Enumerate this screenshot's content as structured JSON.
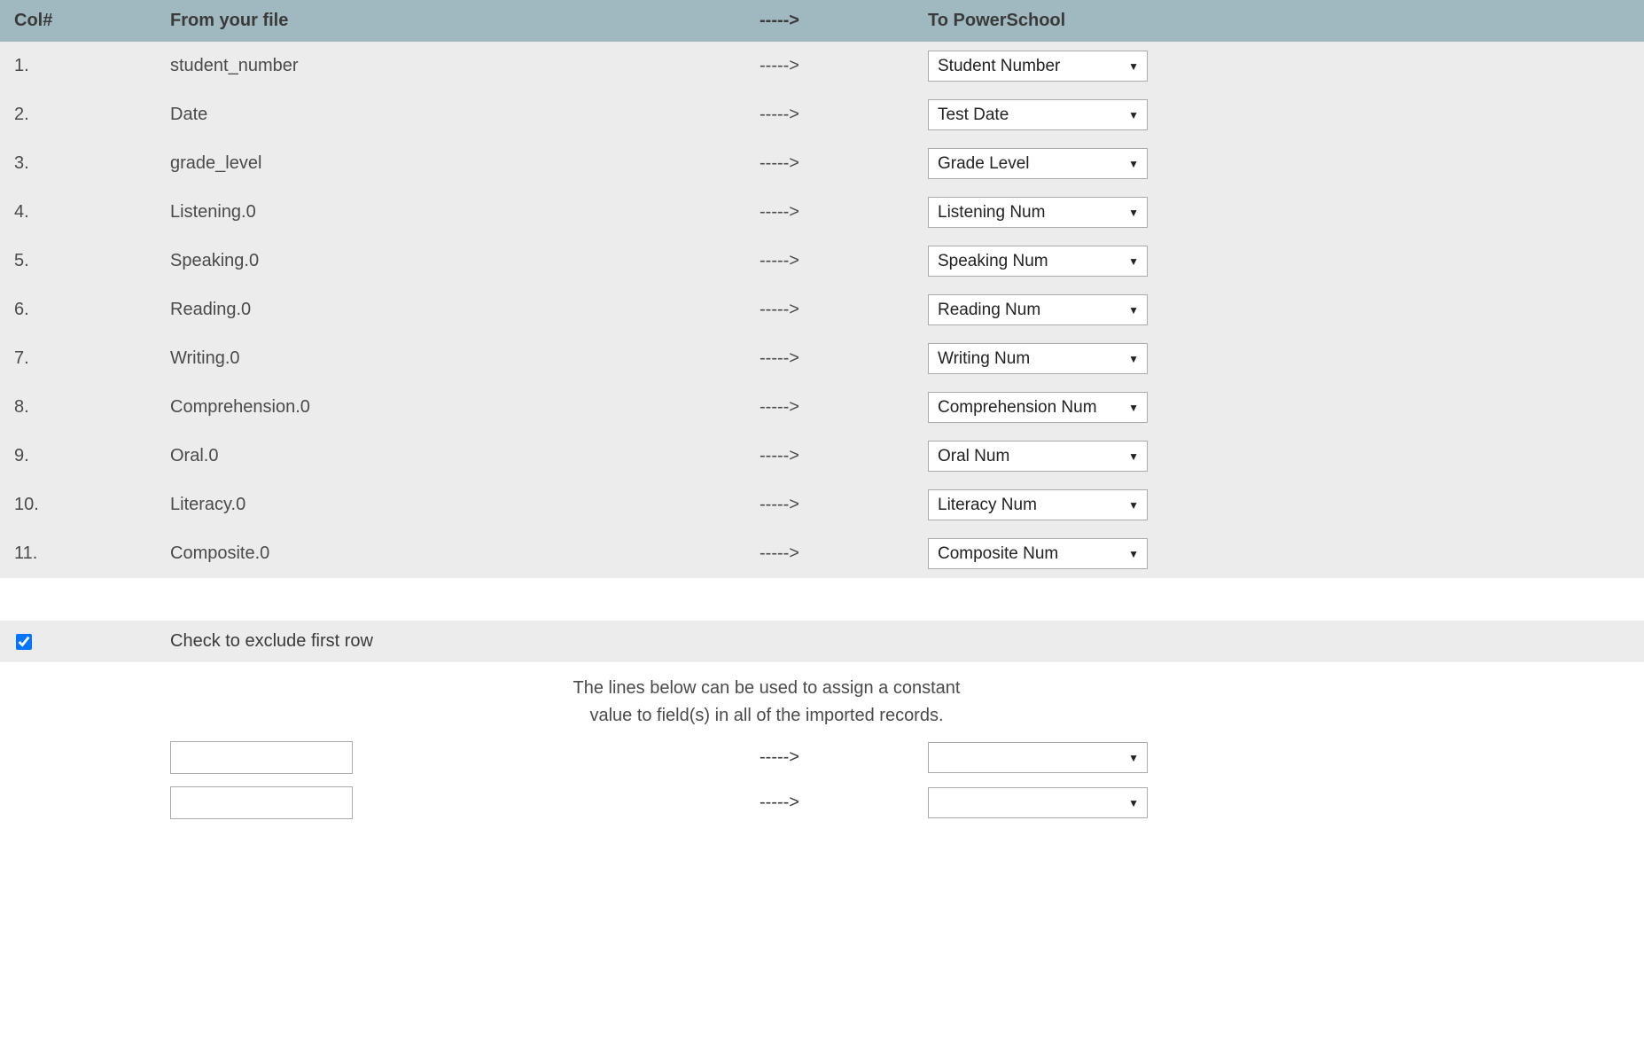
{
  "header": {
    "col_num": "Col#",
    "col_from": "From your file",
    "col_arrow": "----->",
    "col_to": "To PowerSchool"
  },
  "arrow": "----->",
  "rows": [
    {
      "num": "1.",
      "from": "student_number",
      "to": "Student Number"
    },
    {
      "num": "2.",
      "from": "Date",
      "to": "Test Date"
    },
    {
      "num": "3.",
      "from": "grade_level",
      "to": "Grade Level"
    },
    {
      "num": "4.",
      "from": "Listening.0",
      "to": "Listening Num"
    },
    {
      "num": "5.",
      "from": "Speaking.0",
      "to": "Speaking Num"
    },
    {
      "num": "6.",
      "from": "Reading.0",
      "to": "Reading Num"
    },
    {
      "num": "7.",
      "from": "Writing.0",
      "to": "Writing Num"
    },
    {
      "num": "8.",
      "from": "Comprehension.0",
      "to": "Comprehension Num"
    },
    {
      "num": "9.",
      "from": "Oral.0",
      "to": "Oral Num"
    },
    {
      "num": "10.",
      "from": "Literacy.0",
      "to": "Literacy Num"
    },
    {
      "num": "11.",
      "from": "Composite.0",
      "to": "Composite Num"
    }
  ],
  "exclude": {
    "checked": true,
    "label": "Check to exclude first row"
  },
  "note_line1": "The lines below can be used to assign a constant",
  "note_line2": "value to field(s) in all of the imported records.",
  "constants": [
    {
      "value": "",
      "to": ""
    },
    {
      "value": "",
      "to": ""
    }
  ]
}
